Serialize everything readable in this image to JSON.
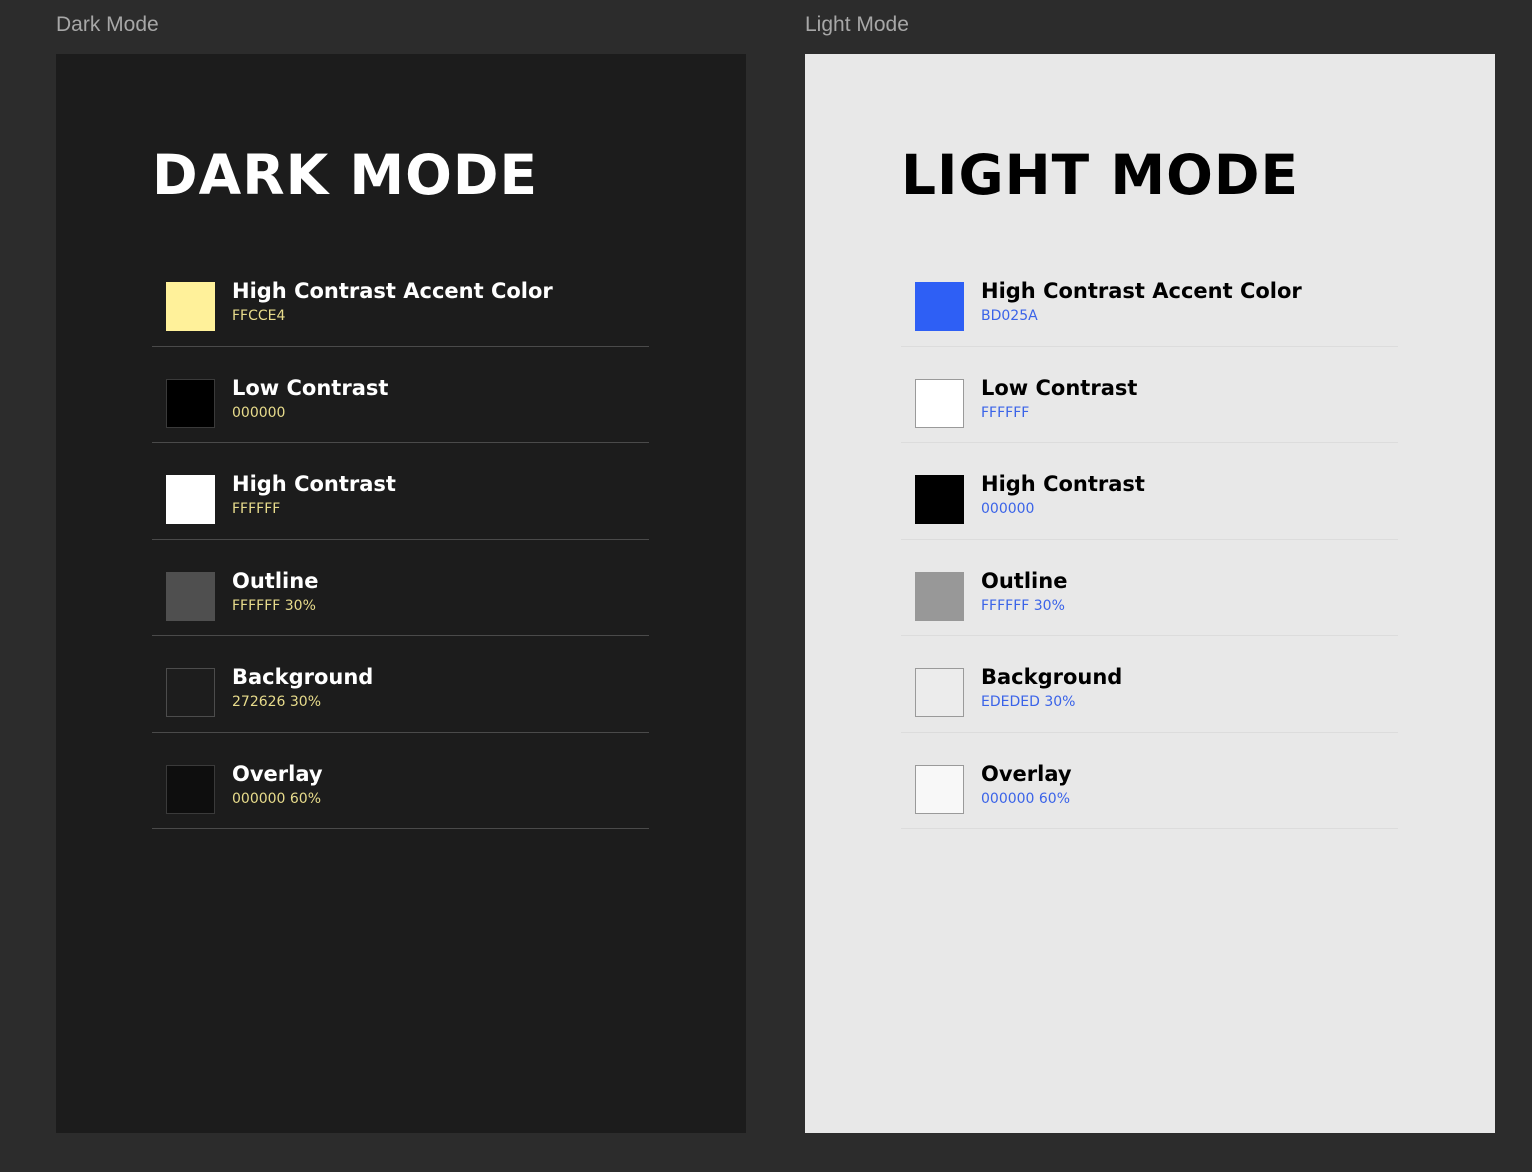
{
  "canvas": {
    "dark_frame_label": "Dark Mode",
    "light_frame_label": "Light Mode"
  },
  "dark": {
    "title": "DARK MODE",
    "text_color": "#ffffff",
    "code_color": "#e8dc8c",
    "background": "#1c1c1c",
    "swatches": [
      {
        "name": "High Contrast Accent Color",
        "code": "FFCCE4",
        "fill": "#fff19a",
        "border": "#fff19a"
      },
      {
        "name": "Low Contrast",
        "code": "000000",
        "fill": "#000000",
        "border": "#3a3a3a"
      },
      {
        "name": "High Contrast",
        "code": "FFFFFF",
        "fill": "#ffffff",
        "border": "#ffffff"
      },
      {
        "name": "Outline",
        "code": "FFFFFF 30%",
        "fill": "#4f4f4f",
        "border": "#4f4f4f"
      },
      {
        "name": "Background",
        "code": "272626 30%",
        "fill": "#1d1d1d",
        "border": "#4c4c4c"
      },
      {
        "name": "Overlay",
        "code": "000000 60%",
        "fill": "#0e0e0e",
        "border": "#3a3a3a"
      }
    ]
  },
  "light": {
    "title": "LIGHT MODE",
    "text_color": "#000000",
    "code_color": "#3a63e8",
    "background": "#e8e8e8",
    "swatches": [
      {
        "name": "High Contrast Accent Color",
        "code": "BD025A",
        "fill": "#2e5ff5",
        "border": "#2e5ff5"
      },
      {
        "name": "Low Contrast",
        "code": "FFFFFF",
        "fill": "#ffffff",
        "border": "#9a9a9a"
      },
      {
        "name": "High Contrast",
        "code": "000000",
        "fill": "#000000",
        "border": "#000000"
      },
      {
        "name": "Outline",
        "code": "FFFFFF 30%",
        "fill": "#989898",
        "border": "#989898"
      },
      {
        "name": "Background",
        "code": "EDEDED 30%",
        "fill": "#ececec",
        "border": "#9a9a9a"
      },
      {
        "name": "Overlay",
        "code": "000000 60%",
        "fill": "#f8f8f8",
        "border": "#9a9a9a"
      }
    ]
  }
}
